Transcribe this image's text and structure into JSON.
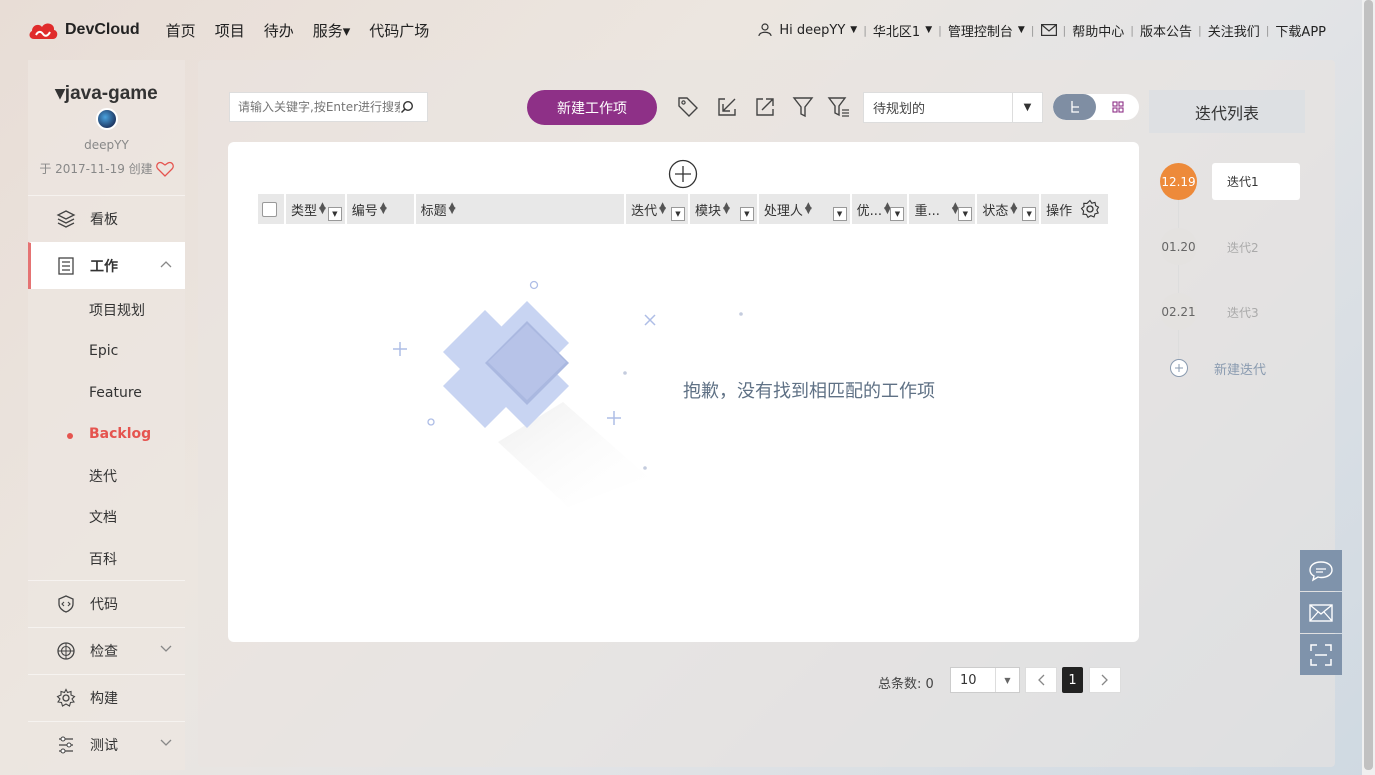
{
  "topbar": {
    "logo_text": "DevCloud",
    "nav": [
      "首页",
      "项目",
      "待办",
      "服务▾",
      "代码广场"
    ],
    "user": "Hi deepYY",
    "region": "华北区1",
    "console": "管理控制台",
    "help": "帮助中心",
    "release": "版本公告",
    "follow": "关注我们",
    "download": "下载APP"
  },
  "project": {
    "name": "▾java-game",
    "owner": "deepYY",
    "created": "于 2017-11-19 创建"
  },
  "sidebar": {
    "board": "看板",
    "work": "工作",
    "work_subs": [
      "项目规划",
      "Epic",
      "Feature",
      "Backlog",
      "迭代",
      "文档",
      "百科"
    ],
    "active_sub": "Backlog",
    "code": "代码",
    "check": "检查",
    "build": "构建",
    "test": "测试"
  },
  "toolbar": {
    "search_placeholder": "请输入关键字,按Enter进行搜索",
    "new_button": "新建工作项",
    "filter_select": "待规划的"
  },
  "table": {
    "columns": [
      "类型",
      "编号",
      "标题",
      "迭代",
      "模块",
      "处理人",
      "优...",
      "重...",
      "状态",
      "操作"
    ],
    "empty_message": "抱歉，没有找到相匹配的工作项"
  },
  "pagination": {
    "total_label": "总条数: 0",
    "page_size": "10",
    "current_page": "1"
  },
  "iterations": {
    "header": "迭代列表",
    "items": [
      {
        "date": "12.19",
        "name": "迭代1",
        "current": true
      },
      {
        "date": "01.20",
        "name": "迭代2",
        "current": false
      },
      {
        "date": "02.21",
        "name": "迭代3",
        "current": false
      }
    ],
    "new_label": "新建迭代"
  },
  "colors": {
    "accent": "#8e3087",
    "active_red": "#e5544f",
    "iteration_current": "#ed8a3a",
    "float_button": "#7f93ab"
  }
}
